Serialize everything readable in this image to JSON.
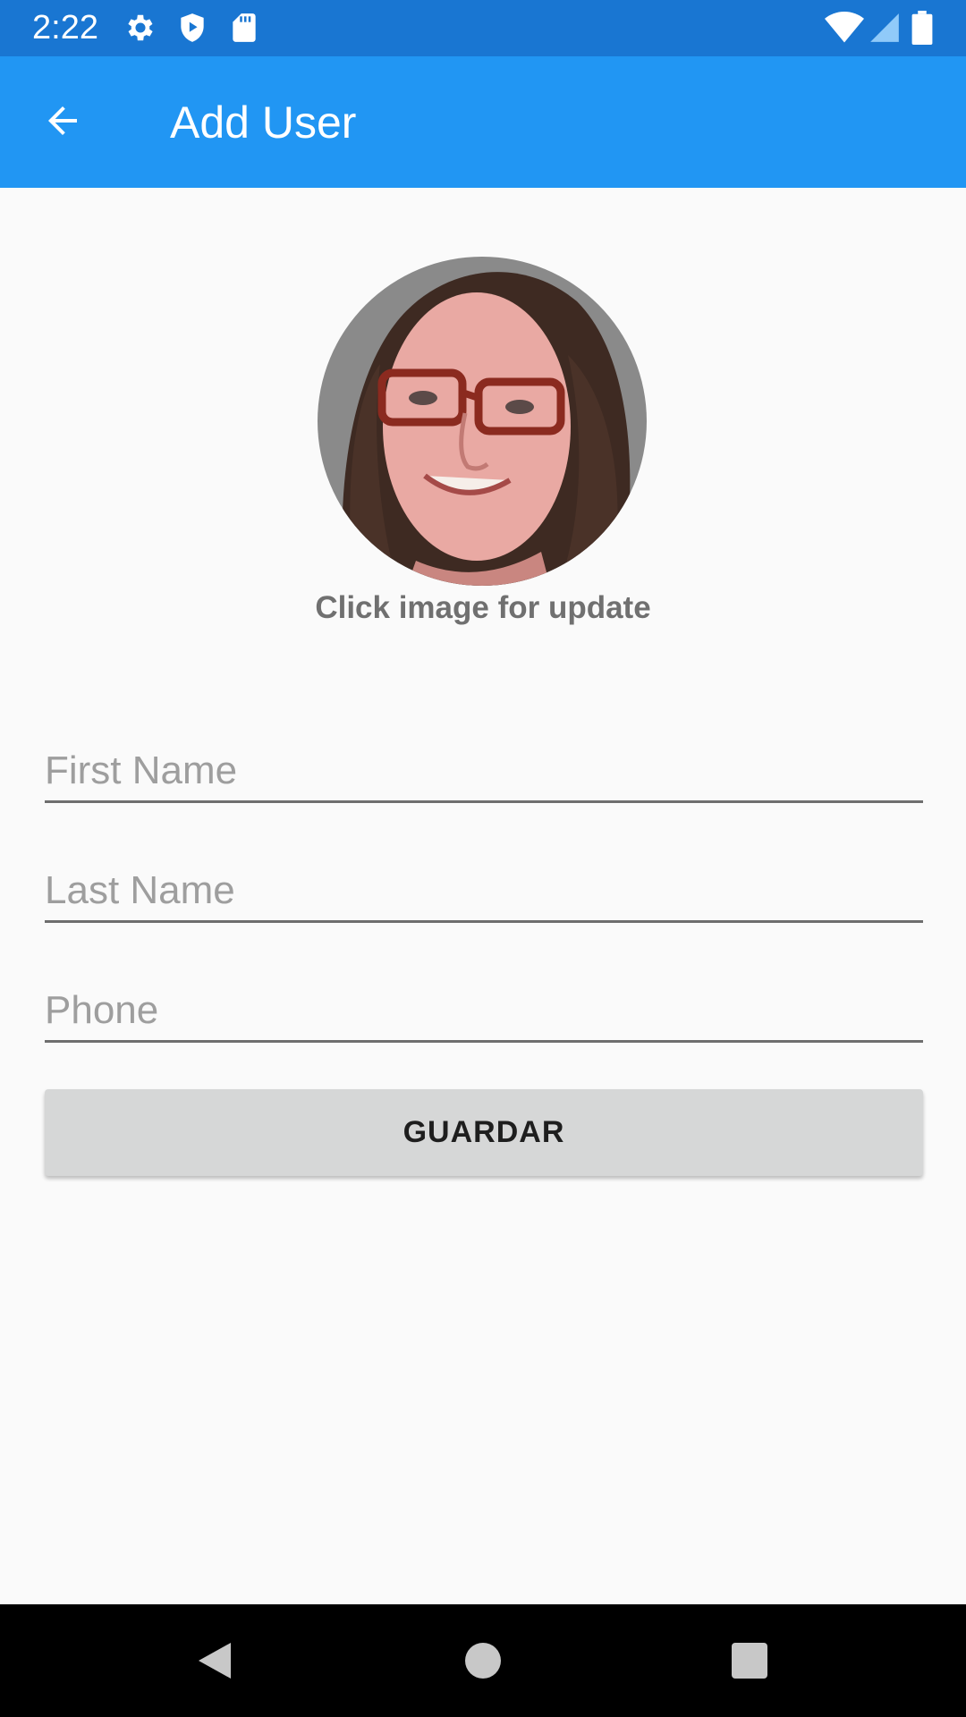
{
  "status_bar": {
    "time": "2:22",
    "left_icons": [
      "settings-icon",
      "shield-play-icon",
      "sd-card-icon"
    ],
    "right_icons": [
      "wifi-icon",
      "cell-signal-icon",
      "battery-icon"
    ],
    "background_color": "#1976d2"
  },
  "app_bar": {
    "title": "Add User",
    "back_icon": "arrow-back-icon",
    "background_color": "#2196f3"
  },
  "avatar": {
    "caption": "Click image for update"
  },
  "form": {
    "first_name": {
      "value": "",
      "placeholder": "First Name"
    },
    "last_name": {
      "value": "",
      "placeholder": "Last Name"
    },
    "phone": {
      "value": "",
      "placeholder": "Phone"
    },
    "save_label": "GUARDAR"
  },
  "nav_bar": {
    "icons": [
      "back-triangle-icon",
      "home-circle-icon",
      "recents-square-icon"
    ]
  }
}
